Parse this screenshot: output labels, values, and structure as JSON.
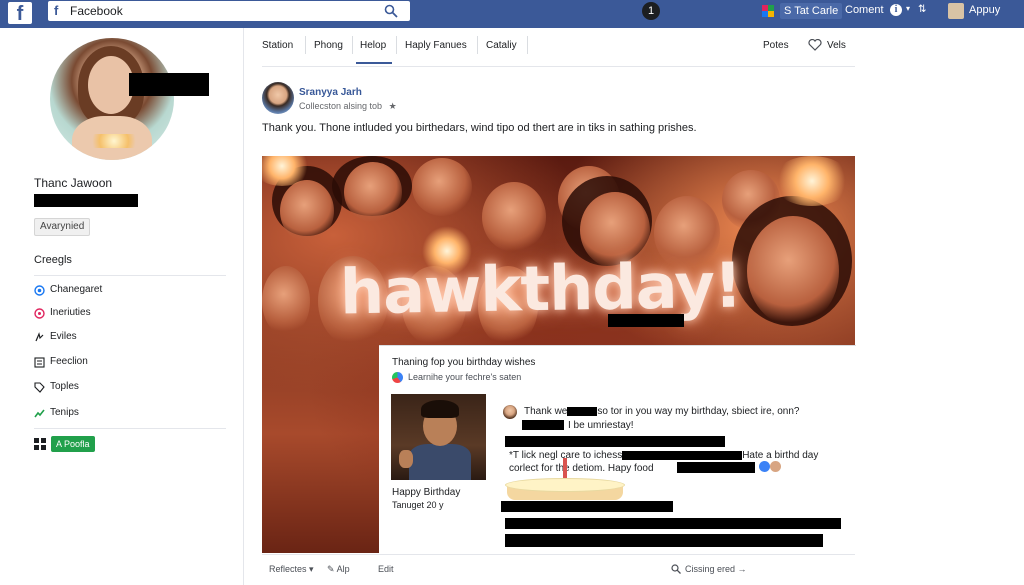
{
  "topbar": {
    "logo": "f",
    "search_fb": "f",
    "search_text": "Facebook",
    "center_badge": "1",
    "stat_label": "S Tat Carle",
    "comment_label": "Coment",
    "info": "i",
    "chev": "▾",
    "link": "⇅",
    "apply_label": "Appuy"
  },
  "sidebar": {
    "name": "Thanc Jawoon",
    "everyone_label": "Avarynied",
    "section_label": "Creegls",
    "items": [
      {
        "label": "Chanegaret",
        "icon": "circle-c-icon",
        "color": "#1877f2"
      },
      {
        "label": "Ineriuties",
        "icon": "pin-icon",
        "color": "#e0245e"
      },
      {
        "label": "Eviles",
        "icon": "events-icon",
        "color": "#1c1e21"
      },
      {
        "label": "Feeclion",
        "icon": "news-feed-icon",
        "color": "#1c1e21"
      },
      {
        "label": "Toples",
        "icon": "tag-icon",
        "color": "#1c1e21"
      },
      {
        "label": "Tenips",
        "icon": "trend-icon",
        "color": "#21a04b"
      }
    ],
    "badge_label": "A Poofla",
    "badge_color": "#21a04b"
  },
  "tabs": {
    "items": [
      "Station",
      "Phong",
      "Helop",
      "Haply Fanues",
      "Cataliy"
    ],
    "right_left": "Potes",
    "right_right": "Vels"
  },
  "post": {
    "author": "Sranyya Jarh",
    "meta": "Collecston alsing tob",
    "meta_star": "★",
    "text": "Thank you. Thone intluded you birthedars, wind tipo od thert are in tiks in sathing prishes.",
    "image_text": "hawkthday!"
  },
  "card": {
    "title": "Thaning fop you birthday wishes",
    "subtitle": "Learnihe your fechre's saten",
    "photo_caption": "Happy Birthday",
    "photo_date": "Tanuget 20 y",
    "comments": {
      "line1_a": "Thank we",
      "line1_b": "so tor in you way my birthday, sbiect ire, onn?",
      "line2": "I be umriestay!",
      "line3_a": "*T lick negl care to ichess",
      "line3_b": "Hate a birthd day",
      "line4": "corlect for the detiom.  Hapy food"
    }
  },
  "actions": {
    "react": "Reflectes",
    "react_chev": "▾",
    "alp": "Alp",
    "edit": "Edit",
    "closing": "Cissing ered",
    "closing_chev": "→"
  },
  "colors": {
    "topbar": "#3b5998",
    "link": "#385898",
    "accent_green": "#21a04b"
  }
}
